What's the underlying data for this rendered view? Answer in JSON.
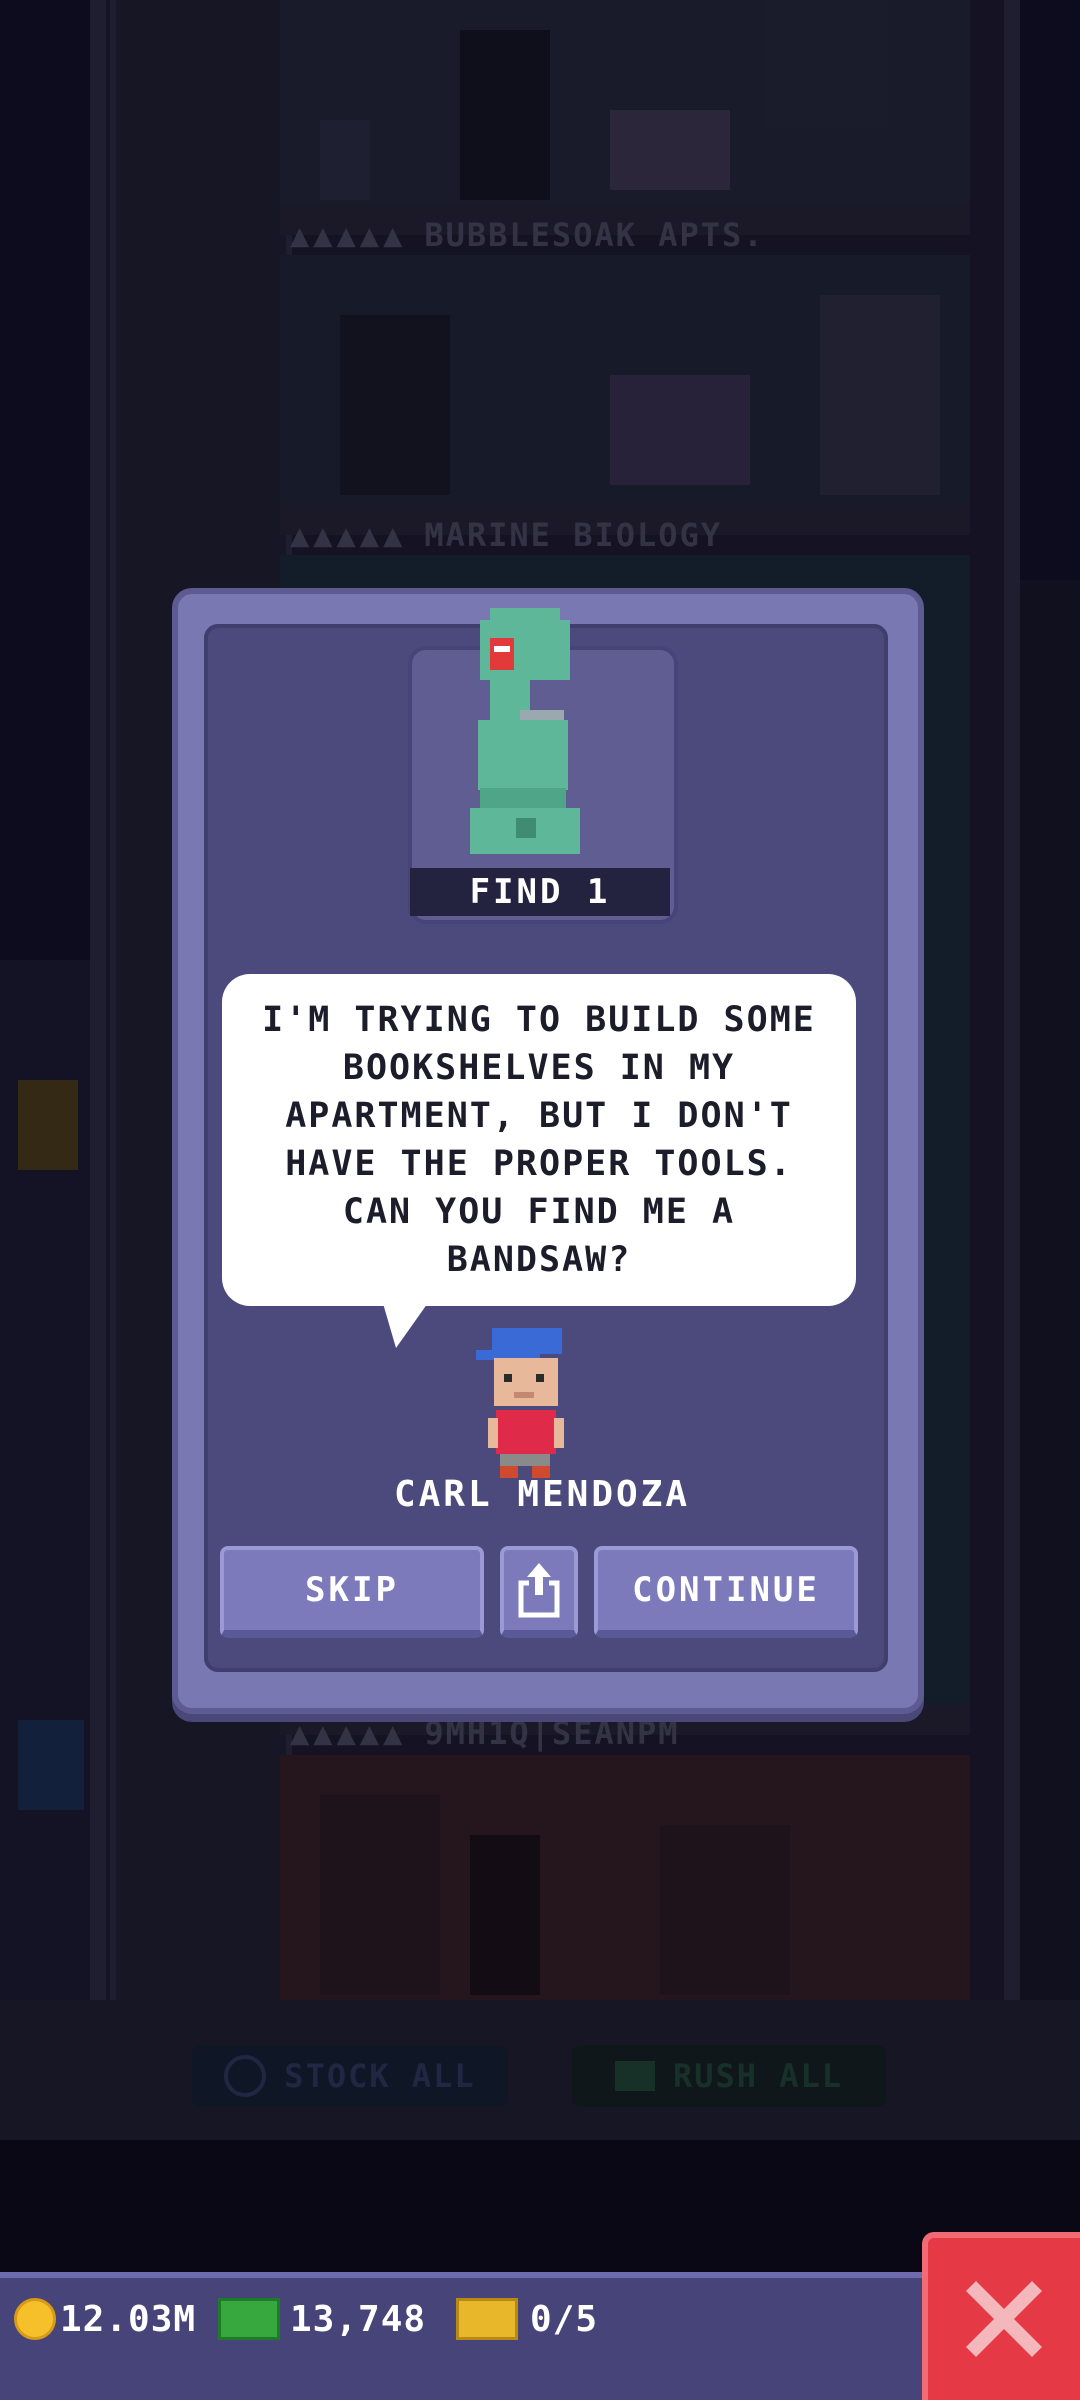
{
  "tower": {
    "floor_labels": [
      {
        "stars": "▲▲▲▲▲",
        "name": "BUBBLESOAK APTS."
      },
      {
        "stars": "▲▲▲▲▲",
        "name": "MARINE BIOLOGY"
      },
      {
        "stars": "▲▲▲▲▲",
        "name": "9MH1Q|SEANPM"
      }
    ],
    "stock_all": "STOCK ALL",
    "rush_all": "RUSH ALL"
  },
  "dialog": {
    "find_label": "FIND 1",
    "item_icon": "bandsaw-icon",
    "message_lines": [
      "I'M TRYING TO BUILD SOME",
      "BOOKSHELVES IN MY",
      "APARTMENT, BUT I DON'T",
      "HAVE THE PROPER TOOLS.",
      "CAN YOU FIND ME A",
      "BANDSAW?"
    ],
    "npc_name": "CARL MENDOZA",
    "skip_label": "SKIP",
    "share_icon": "share-icon",
    "continue_label": "CONTINUE"
  },
  "hud": {
    "coins": "12.03M",
    "bux": "13,748",
    "tickets": "0/5",
    "close_icon": "close-icon"
  },
  "colors": {
    "dialog_bg": "#4c4a7c",
    "dialog_border": "#7a78b2",
    "button": "#7c7aba",
    "close_red": "#e53a46",
    "coin_gold": "#f5c02a",
    "bux_green": "#36a83e"
  }
}
